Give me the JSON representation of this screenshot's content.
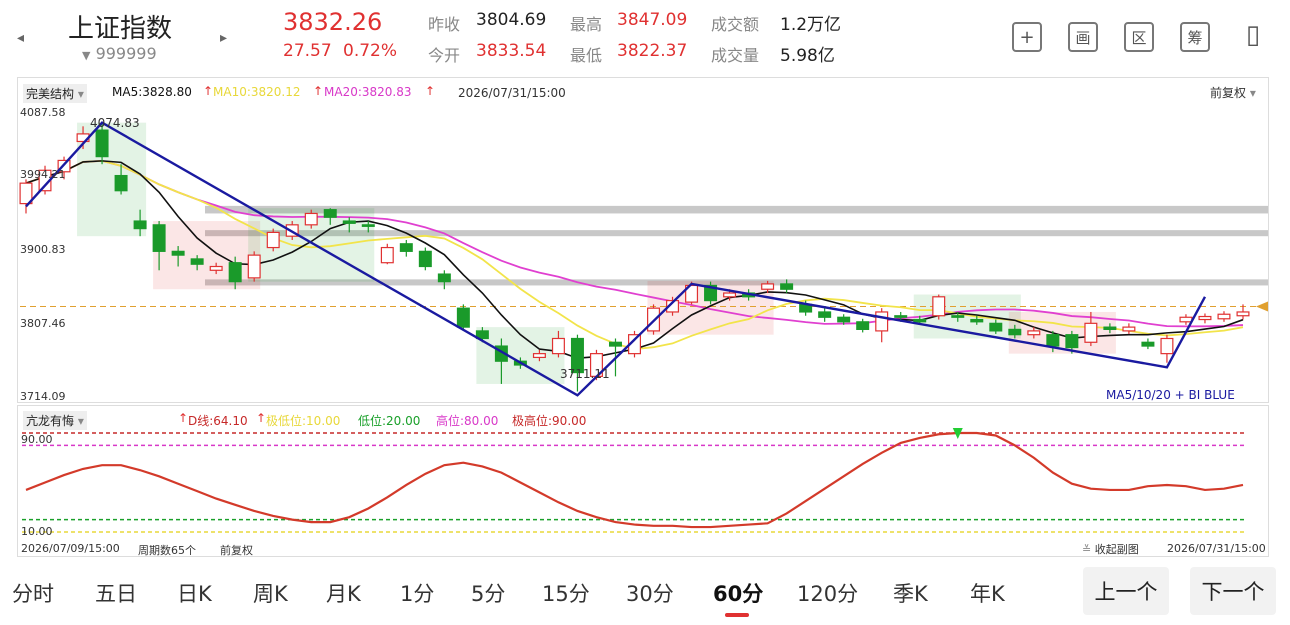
{
  "header": {
    "name": "上证指数",
    "code": "999999",
    "price": "3832.26",
    "change": "27.57",
    "change_pct": "0.72%",
    "prev_close_label": "昨收",
    "prev_close": "3804.69",
    "open_label": "今开",
    "open": "3833.54",
    "high_label": "最高",
    "high": "3847.09",
    "low_label": "最低",
    "low": "3822.37",
    "amount_label": "成交额",
    "amount": "1.2万亿",
    "volume_label": "成交量",
    "volume": "5.98亿",
    "icons": [
      "plus-icon",
      "layout-icon",
      "range-icon",
      "chip-icon",
      "devices-icon"
    ],
    "icon_glyphs": [
      "+",
      "画",
      "区",
      "筹",
      "▯"
    ]
  },
  "main_chart": {
    "indicator_select": "完美结构",
    "ma5": "MA5:3828.80",
    "ma10": "MA10:3820.12",
    "ma20": "MA20:3820.83",
    "datetime": "2026/07/31/15:00",
    "adjust": "前复权",
    "y_labels": [
      "4087.58",
      "3994.21",
      "3900.83",
      "3807.46",
      "3714.09"
    ],
    "annot_high": "4074.83",
    "annot_low": "3711.11",
    "legend_note": "MA5/10/20 + BI BLUE",
    "colors": {
      "up": "#e03131",
      "down": "#1a9a2a",
      "ma5": "#111111",
      "ma10": "#f2e44a",
      "ma20": "#e040d0",
      "bi": "#1a1aa0"
    }
  },
  "sub_chart": {
    "indicator_select": "亢龙有悔",
    "d_line": "D线:64.10",
    "extreme_low": "极低位:10.00",
    "low_level": "低位:20.00",
    "high_level": "高位:80.00",
    "extreme_high": "极高位:90.00",
    "y_top": "90.00",
    "y_bottom": "10.00",
    "start_time": "2026/07/09/15:00",
    "period_count": "周期数65个",
    "adjust": "前复权",
    "collapse": "收起副图",
    "end_time": "2026/07/31/15:00"
  },
  "chart_data": {
    "type": "candlestick",
    "x": "65 hourly bars, 2026/07/09/15:00 – 2026/07/31/15:00",
    "ylim": [
      3714.09,
      4087.58
    ],
    "candles": [
      [
        3968,
        3995,
        3955,
        4000
      ],
      [
        3985,
        4012,
        3980,
        4018
      ],
      [
        4010,
        4025,
        4000,
        4030
      ],
      [
        4050,
        4060,
        4040,
        4070
      ],
      [
        4065,
        4030,
        4020,
        4074.83
      ],
      [
        4005,
        3985,
        3980,
        4020
      ],
      [
        3945,
        3935,
        3925,
        3960
      ],
      [
        3940,
        3905,
        3880,
        3945
      ],
      [
        3905,
        3900,
        3885,
        3912
      ],
      [
        3895,
        3888,
        3880,
        3900
      ],
      [
        3880,
        3885,
        3875,
        3890
      ],
      [
        3890,
        3865,
        3855,
        3898
      ],
      [
        3870,
        3900,
        3865,
        3905
      ],
      [
        3910,
        3930,
        3905,
        3935
      ],
      [
        3925,
        3940,
        3920,
        3945
      ],
      [
        3940,
        3955,
        3935,
        3960
      ],
      [
        3960,
        3950,
        3940,
        3962
      ],
      [
        3945,
        3942,
        3930,
        3950
      ],
      [
        3940,
        3938,
        3930,
        3945
      ],
      [
        3890,
        3910,
        3888,
        3915
      ],
      [
        3915,
        3905,
        3898,
        3920
      ],
      [
        3905,
        3885,
        3880,
        3910
      ],
      [
        3875,
        3865,
        3855,
        3880
      ],
      [
        3830,
        3805,
        3800,
        3835
      ],
      [
        3800,
        3790,
        3785,
        3805
      ],
      [
        3780,
        3760,
        3730,
        3790
      ],
      [
        3760,
        3755,
        3750,
        3765
      ],
      [
        3765,
        3770,
        3760,
        3775
      ],
      [
        3770,
        3790,
        3765,
        3800
      ],
      [
        3790,
        3745,
        3720,
        3795
      ],
      [
        3740,
        3770,
        3735,
        3775
      ],
      [
        3785,
        3780,
        3740,
        3790
      ],
      [
        3770,
        3795,
        3765,
        3800
      ],
      [
        3800,
        3830,
        3795,
        3835
      ],
      [
        3825,
        3840,
        3820,
        3845
      ],
      [
        3838,
        3860,
        3835,
        3865
      ],
      [
        3860,
        3840,
        3835,
        3865
      ],
      [
        3845,
        3850,
        3840,
        3855
      ],
      [
        3850,
        3845,
        3840,
        3855
      ],
      [
        3855,
        3862,
        3850,
        3866
      ],
      [
        3862,
        3855,
        3850,
        3868
      ],
      [
        3835,
        3825,
        3820,
        3840
      ],
      [
        3825,
        3818,
        3812,
        3830
      ],
      [
        3818,
        3812,
        3808,
        3822
      ],
      [
        3812,
        3802,
        3798,
        3816
      ],
      [
        3800,
        3825,
        3785,
        3830
      ],
      [
        3820,
        3818,
        3812,
        3825
      ],
      [
        3815,
        3812,
        3808,
        3820
      ],
      [
        3820,
        3845,
        3815,
        3848
      ],
      [
        3820,
        3818,
        3812,
        3825
      ],
      [
        3815,
        3812,
        3808,
        3820
      ],
      [
        3810,
        3800,
        3796,
        3815
      ],
      [
        3802,
        3795,
        3790,
        3808
      ],
      [
        3795,
        3800,
        3790,
        3805
      ],
      [
        3795,
        3780,
        3772,
        3800
      ],
      [
        3795,
        3778,
        3770,
        3800
      ],
      [
        3785,
        3810,
        3780,
        3825
      ],
      [
        3805,
        3802,
        3797,
        3810
      ],
      [
        3800,
        3805,
        3796,
        3810
      ],
      [
        3785,
        3780,
        3776,
        3790
      ],
      [
        3770,
        3790,
        3758,
        3795
      ],
      [
        3812,
        3818,
        3808,
        3822
      ],
      [
        3815,
        3819,
        3810,
        3823
      ],
      [
        3816,
        3822,
        3812,
        3826
      ],
      [
        3820,
        3825,
        3815,
        3835
      ]
    ],
    "sub_series": {
      "name": "D线",
      "ylim": [
        10,
        90
      ],
      "levels": {
        "extreme_low": 10,
        "low": 20,
        "high": 80,
        "extreme_high": 90
      },
      "values": [
        44,
        50,
        56,
        61,
        64,
        64,
        60,
        55,
        49,
        43,
        37,
        32,
        27,
        23,
        20,
        18,
        18,
        22,
        29,
        38,
        48,
        57,
        64,
        66,
        63,
        58,
        50,
        42,
        34,
        27,
        22,
        18,
        16,
        15,
        15,
        14,
        14,
        15,
        16,
        17,
        25,
        35,
        45,
        55,
        65,
        74,
        82,
        86,
        89,
        90,
        90,
        88,
        80,
        70,
        58,
        49,
        45,
        44,
        44,
        47,
        48,
        47,
        44,
        45,
        48
      ]
    }
  },
  "bottom_tabs": [
    "分时",
    "五日",
    "日K",
    "周K",
    "月K",
    "1分",
    "5分",
    "15分",
    "30分",
    "60分",
    "120分",
    "季K",
    "年K"
  ],
  "active_tab": "60分",
  "prev_button": "上一个",
  "next_button": "下一个"
}
